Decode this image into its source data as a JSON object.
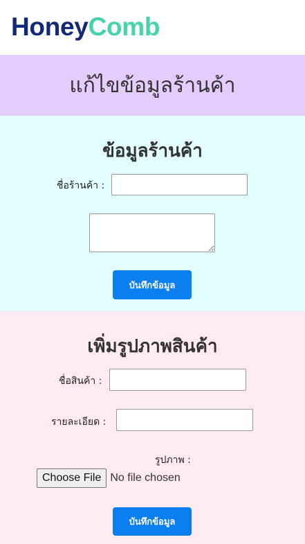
{
  "brand": {
    "part1": "Honey",
    "part2": "Comb",
    "color1": "#14287a",
    "color2": "#45d4ab"
  },
  "header": {
    "title": "แก้ไขข้อมูลร้านค้า",
    "background": "#e5ccff"
  },
  "shop_info": {
    "title": "ข้อมูลร้านค้า",
    "name_label": "ชื่อร้านค้า :",
    "name_value": "",
    "description_value": "",
    "save_button": "บันทึกข้อมูล",
    "background": "#e2fdfd"
  },
  "product": {
    "title": "เพิ่มรูปภาพสินค้า",
    "name_label": "ชื่อสินค้า :",
    "name_value": "",
    "detail_label": "รายละเอียด :",
    "detail_value": "",
    "image_label": "รูปภาพ :",
    "file_button": "Choose File",
    "file_status": "No file chosen",
    "save_button": "บันทึกข้อมูล",
    "background": "#ffebf1"
  },
  "colors": {
    "primary_button": "#0b7ff0"
  }
}
